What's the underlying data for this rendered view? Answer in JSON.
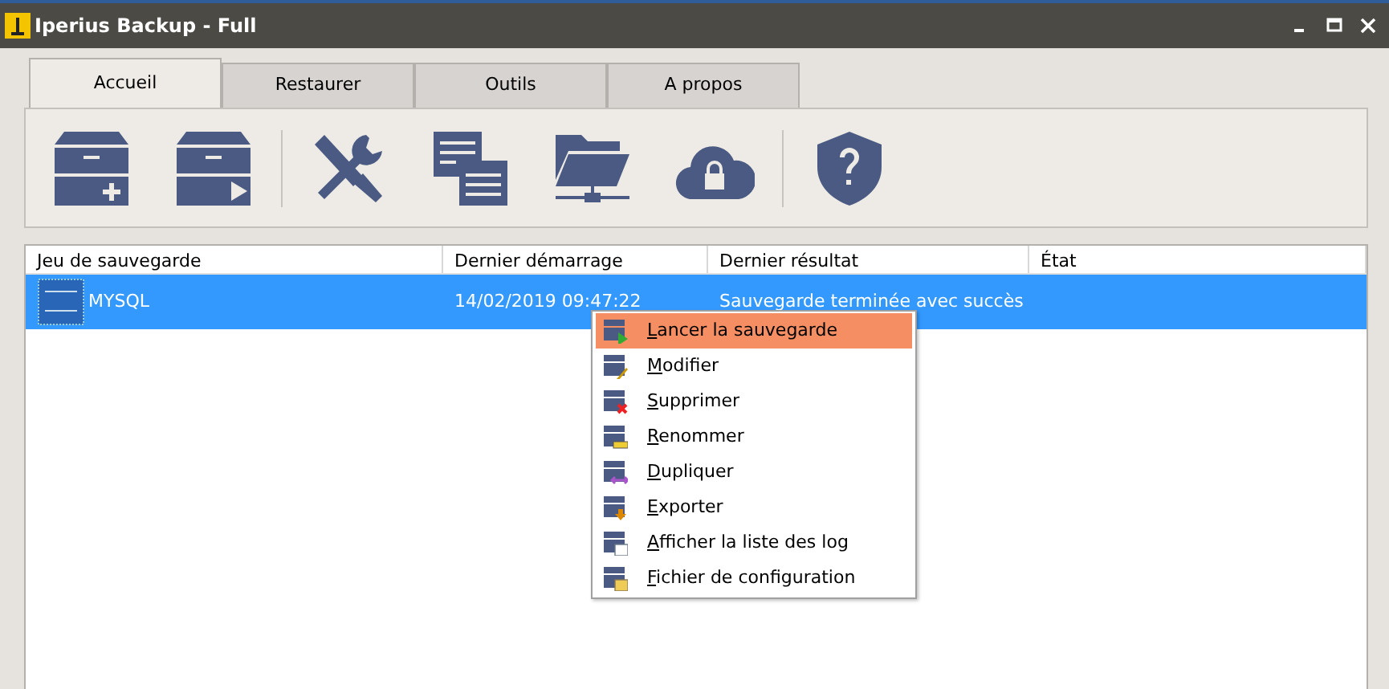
{
  "window": {
    "title": "Iperius Backup - Full"
  },
  "tabs": [
    {
      "label": "Accueil",
      "selected": true
    },
    {
      "label": "Restaurer",
      "selected": false
    },
    {
      "label": "Outils",
      "selected": false
    },
    {
      "label": "A propos",
      "selected": false
    }
  ],
  "toolbar": [
    {
      "kind": "new-backup"
    },
    {
      "kind": "run-backup"
    },
    {
      "kind": "separator"
    },
    {
      "kind": "tools"
    },
    {
      "kind": "log"
    },
    {
      "kind": "network-folder"
    },
    {
      "kind": "cloud"
    },
    {
      "kind": "separator"
    },
    {
      "kind": "help"
    }
  ],
  "table": {
    "columns": [
      "Jeu de sauvegarde",
      "Dernier démarrage",
      "Dernier résultat",
      "État"
    ],
    "rows": [
      {
        "cells": [
          "MYSQL",
          "14/02/2019 09:47:22",
          "Sauvegarde terminée avec succès",
          ""
        ],
        "selected": true
      }
    ]
  },
  "context_menu": {
    "items": [
      {
        "label": "Lancer la sauvegarde",
        "kind": "run",
        "selected": true,
        "mnemonic": true
      },
      {
        "label": "Modifier",
        "kind": "edit",
        "selected": false,
        "mnemonic": true
      },
      {
        "label": "Supprimer",
        "kind": "delete",
        "selected": false,
        "mnemonic": true
      },
      {
        "label": "Renommer",
        "kind": "rename",
        "selected": false,
        "mnemonic": true
      },
      {
        "label": "Dupliquer",
        "kind": "duplicate",
        "selected": false,
        "mnemonic": true
      },
      {
        "label": "Exporter",
        "kind": "export",
        "selected": false,
        "mnemonic": true
      },
      {
        "label": "Afficher la liste des log",
        "kind": "log",
        "selected": false,
        "mnemonic": true
      },
      {
        "label": "Fichier de configuration",
        "kind": "config",
        "selected": false,
        "mnemonic": true
      }
    ]
  }
}
